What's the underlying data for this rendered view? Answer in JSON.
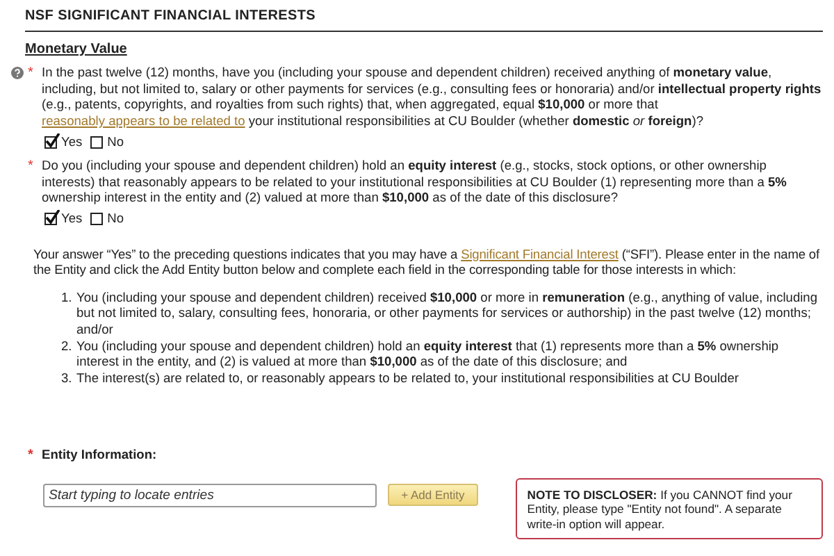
{
  "section_title": "NSF SIGNIFICANT FINANCIAL INTERESTS",
  "subheading": "Monetary Value",
  "questions": [
    {
      "help": true,
      "required": "*",
      "text_before": "In the past twelve (12) months, have you (including your spouse and dependent children) received anything of **monetary value**, including, but not limited to, salary or other payments for services (e.g., consulting fees or honoraria) and/or **intellectual property rights** (e.g., patents, copyrights, and royalties from such rights) that, when aggregated, equal **$10,000** or more that",
      "link": "reasonably appears to be related to",
      "text_after": "your institutional responsibilities at CU Boulder (whether **domestic** *or* **foreign**)?",
      "options": [
        {
          "label": "Yes",
          "checked": true
        },
        {
          "label": "No",
          "checked": false
        }
      ]
    },
    {
      "help": false,
      "required": "*",
      "text_before": "Do you (including your spouse and dependent children) hold an **equity interest** (e.g., stocks, stock options, or other ownership interests) that reasonably appears to be related to your institutional responsibilities at CU Boulder (1) representing more than a **5%** ownership interest in the entity and (2) valued at more than **$10,000** as of the date of this disclosure?",
      "options": [
        {
          "label": "Yes",
          "checked": true
        },
        {
          "label": "No",
          "checked": false
        }
      ]
    }
  ],
  "intro": {
    "text_before": "Your answer “Yes” to the preceding questions indicates that you may have a",
    "link": "Significant Financial Interest",
    "text_after": "(“SFI”). Please enter in the name of the Entity and click the Add Entity button below and complete each field in the corresponding table for those interests in which:"
  },
  "criteria": [
    {
      "number": "1.",
      "text": "You (including your spouse and dependent children) received **$10,000** or more in **remuneration** (e.g., anything of value, including but not limited to, salary, consulting fees, honoraria, or other payments for services or authorship) in the past twelve (12) months; and/or"
    },
    {
      "number": "2.",
      "text": "You (including your spouse and dependent children) hold an **equity interest** that (1) represents more than a **5%** ownership interest in the entity, and (2) is valued at more than **$10,000** as of the date of this disclosure; and"
    },
    {
      "number": "3.",
      "text": "The interest(s) are related to, or reasonably appears to be related to, your institutional responsibilities at CU Boulder"
    }
  ],
  "entity": {
    "required": "*",
    "label": "Entity Information:",
    "placeholder": "Start typing to locate entries",
    "button": "+ Add Entity",
    "note_title": "NOTE TO DISCLOSER:",
    "note_text": "If you CANNOT find your Entity, please type \"Entity not found\". A separate write-in option will appear."
  }
}
